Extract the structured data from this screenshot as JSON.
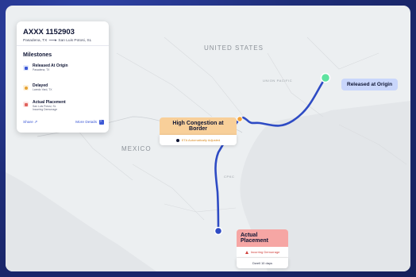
{
  "shipment": {
    "id": "AXXX 1152903",
    "origin": "Pasadena, TX",
    "destination": "San Luis Potosi, SL",
    "milestones_heading": "Milestones",
    "milestones": [
      {
        "title": "Released At Origin",
        "detail": "Pasadena, TX",
        "icon": "ship-icon",
        "color": "#3d59d6",
        "bg": "#dfe6fc"
      },
      {
        "title": "Delayed",
        "detail": "Laredo Yard, TX",
        "icon": "clock-icon",
        "color": "#e6a334",
        "bg": "#fdf0d8"
      },
      {
        "title": "Actual Placement",
        "detail": "San Luis Potosi, SL",
        "detail2": "Incurring Demurrage",
        "icon": "placement-icon",
        "color": "#e0625c",
        "bg": "#fde2e1"
      }
    ],
    "share_label": "Share",
    "more_label": "More Details"
  },
  "map": {
    "country_labels": [
      "UNITED STATES",
      "MEXICO"
    ],
    "railroad_labels": [
      "UNION PACIFIC",
      "CPKC"
    ],
    "route_color": "#2e4bc4"
  },
  "callouts": {
    "released": "Released at Origin",
    "congestion": {
      "title": "High Congestion at Border",
      "note": "ETA Automatically Adjusted"
    },
    "placement": {
      "title": "Actual Placement",
      "warning": "Incurring Demurrage",
      "dwell": "Dwell 10 days"
    }
  }
}
